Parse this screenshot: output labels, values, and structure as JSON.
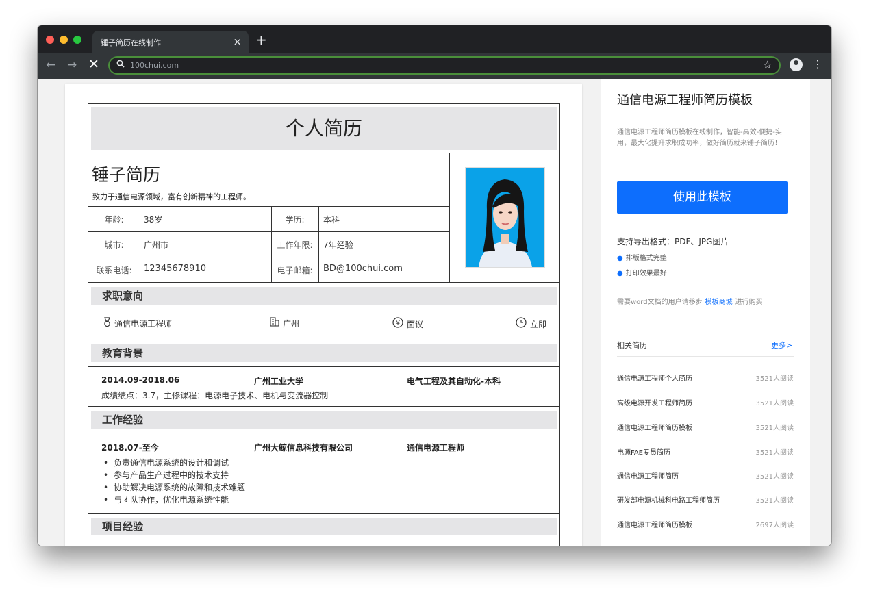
{
  "browser": {
    "tab_title": "锤子简历在线制作",
    "tab_close": "×",
    "new_tab": "+",
    "url": "100chui.com",
    "icons": {
      "back": "←",
      "forward": "→",
      "stop": "✕",
      "search": "⚲",
      "star": "☆",
      "menu": "⋮"
    }
  },
  "resume": {
    "title": "个人简历",
    "name": "锤子简历",
    "motto": "致力于通信电源领域，富有创新精神的工程师。",
    "info": {
      "age_label": "年龄:",
      "age": "38岁",
      "education_label": "学历:",
      "education": "本科",
      "city_label": "城市:",
      "city": "广州市",
      "experience_label": "工作年限:",
      "experience": "7年经验",
      "phone_label": "联系电话:",
      "phone": "12345678910",
      "email_label": "电子邮箱:",
      "email": "BD@100chui.com"
    },
    "intent": {
      "heading": "求职意向",
      "position": "通信电源工程师",
      "location": "广州",
      "salary": "面议",
      "availability": "立即"
    },
    "education": {
      "heading": "教育背景",
      "period": "2014.09-2018.06",
      "school": "广州工业大学",
      "major": "电气工程及其自动化-本科",
      "detail": "成绩绩点：3.7，主修课程：电源电子技术、电机与变流器控制"
    },
    "work": {
      "heading": "工作经验",
      "period": "2018.07-至今",
      "company": "广州大鲸信息科技有限公司",
      "position": "通信电源工程师",
      "duties": [
        "负责通信电源系统的设计和调试",
        "参与产品生产过程中的技术支持",
        "协助解决电源系统的故障和技术难题",
        "与团队协作，优化电源系统性能"
      ]
    },
    "project": {
      "heading": "项目经验"
    }
  },
  "sidebar": {
    "title": "通信电源工程师简历模板",
    "description": "通信电源工程师简历模板在线制作，智能-高效-便捷-实用，最大化提升求职成功率，做好简历就来锤子简历！",
    "use_button": "使用此模板",
    "formats": "支持导出格式：PDF、JPG图片",
    "features": [
      "排版格式完整",
      "打印效果最好"
    ],
    "word_note_prefix": "需要word文档的用户请移步",
    "word_note_link": "模板商城",
    "word_note_suffix": "进行购买",
    "related_heading": "相关简历",
    "more_link": "更多>",
    "related": [
      {
        "name": "通信电源工程师个人简历",
        "count": "3521人阅读"
      },
      {
        "name": "高级电源开发工程师简历",
        "count": "3521人阅读"
      },
      {
        "name": "通信电源工程师简历模板",
        "count": "3521人阅读"
      },
      {
        "name": "电源FAE专员简历",
        "count": "3521人阅读"
      },
      {
        "name": "通信电源工程师简历",
        "count": "3521人阅读"
      },
      {
        "name": "研发部电源机械科电路工程师简历",
        "count": "3521人阅读"
      },
      {
        "name": "通信电源工程师简历模板",
        "count": "2697人阅读"
      }
    ]
  },
  "colors": {
    "accent": "#0d6efd",
    "section_bg": "#e5e5e7",
    "chrome_dark": "#202124",
    "omnibox_border": "#4a8f3a"
  }
}
